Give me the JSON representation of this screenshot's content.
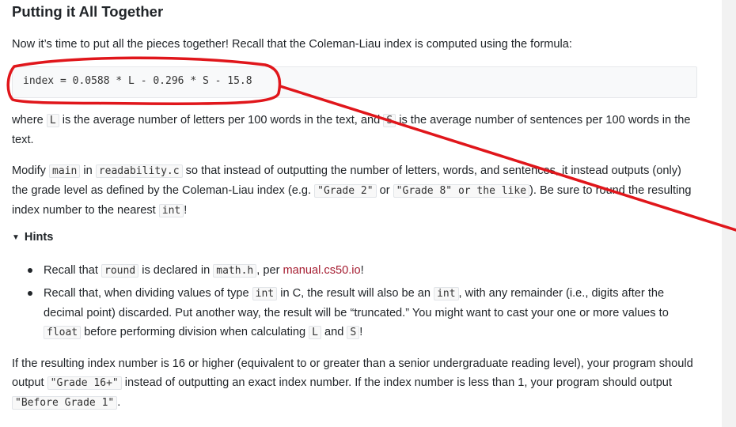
{
  "section": {
    "title": "Putting it All Together",
    "intro": "Now it’s time to put all the pieces together! Recall that the Coleman-Liau index is computed using the formula:",
    "formula": "index = 0.0588 * L - 0.296 * S - 15.8"
  },
  "para2": {
    "t1": "where ",
    "c1": "L",
    "t2": " is the average number of letters per 100 words in the text, and ",
    "c2": "S",
    "t3": " is the average number of sentences per 100 words in the text."
  },
  "para3": {
    "t1": "Modify ",
    "c1": "main",
    "t2": " in ",
    "c2": "readability.c",
    "t3": " so that instead of outputting the number of letters, words, and sentences, it instead outputs (only) the grade level as defined by the Coleman-Liau index (e.g. ",
    "c3": "\"Grade 2\"",
    "t4": " or ",
    "c4": "\"Grade 8\" or the like",
    "t5": "). Be sure to round the resulting index number to the nearest ",
    "c5": "int",
    "t6": "!"
  },
  "hints": {
    "summary": "Hints",
    "item1": {
      "t1": "Recall that ",
      "c1": "round",
      "t2": " is declared in ",
      "c2": "math.h",
      "t3": ", per ",
      "link": "manual.cs50.io",
      "t4": "!"
    },
    "item2": {
      "t1": "Recall that, when dividing values of type ",
      "c1": "int",
      "t2": " in C, the result will also be an ",
      "c2": "int",
      "t3": ", with any remainder (i.e., digits after the decimal point) discarded. Put another way, the result will be “truncated.” You might want to cast your one or more values to ",
      "c3": "float",
      "t4": " before performing division when calculating ",
      "c4": "L",
      "t5": " and ",
      "c5": "S",
      "t6": "!"
    }
  },
  "para4": {
    "t1": "If the resulting index number is 16 or higher (equivalent to or greater than a senior undergraduate reading level), your program should output ",
    "c1": "\"Grade 16+\"",
    "t2": " instead of outputting an exact index number. If the index number is less than 1, your program should output ",
    "c2": "\"Before Grade 1\"",
    "t3": "."
  },
  "annotation": {
    "color": "#e0161b"
  }
}
